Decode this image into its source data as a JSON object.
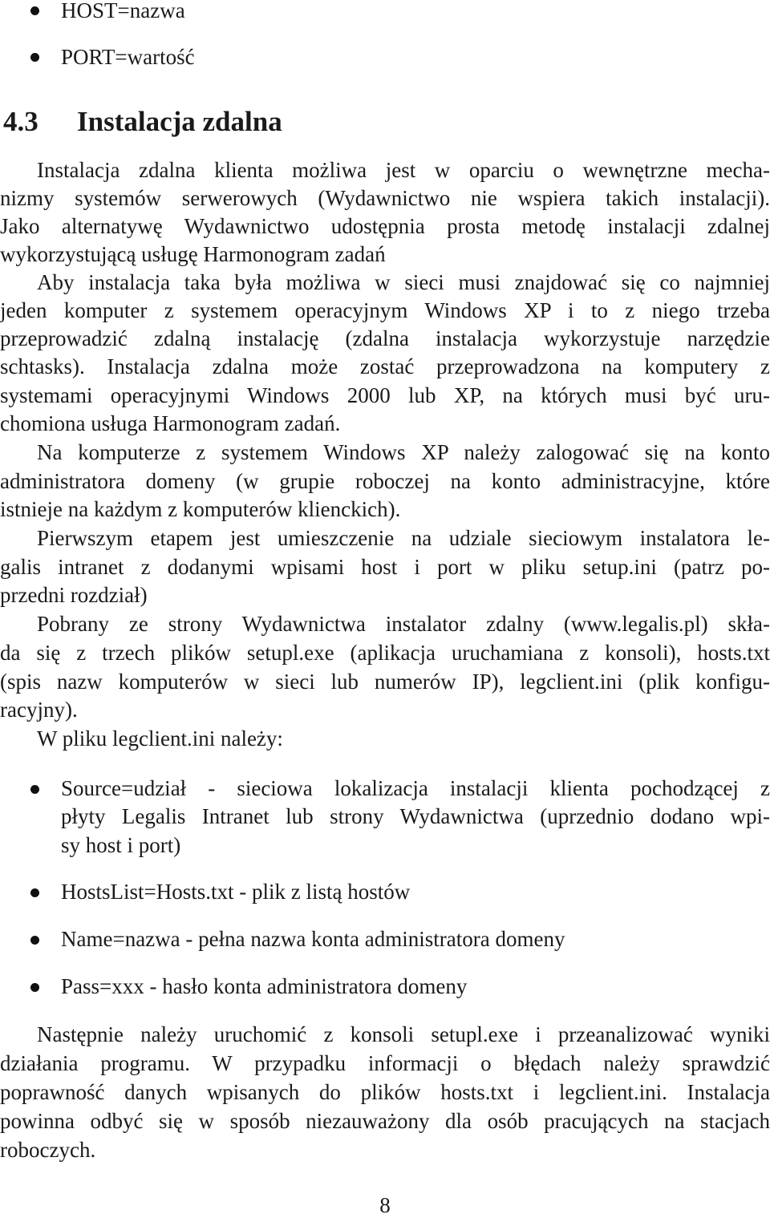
{
  "top_bullets": [
    "HOST=nazwa",
    "PORT=wartość"
  ],
  "section": {
    "number": "4.3",
    "title": "Instalacja zdalna"
  },
  "body_lines": [
    "Instalacja zdalna klienta możliwa jest w oparciu o wewnętrzne mecha-",
    "nizmy systemów serwerowych (Wydawnictwo nie wspiera takich instalacji).",
    "Jako alternatywę Wydawnictwo udostępnia prosta metodę instalacji zdalnej",
    "wykorzystującą usługę Harmonogram zadań",
    "Aby instalacja taka była możliwa w sieci musi znajdować się co najmniej",
    "jeden komputer z systemem operacyjnym Windows XP i to z niego trzeba",
    "przeprowadzić zdalną instalację (zdalna instalacja wykorzystuje narzędzie",
    "schtasks). Instalacja zdalna może zostać przeprowadzona na komputery z",
    "systemami operacyjnymi Windows 2000 lub XP, na których musi być uru-",
    "chomiona usługa Harmonogram zadań.",
    "Na komputerze z systemem Windows XP należy zalogować się na konto",
    "administratora domeny (w grupie roboczej na konto administracyjne, które",
    "istnieje na każdym z komputerów klienckich).",
    "Pierwszym etapem jest umieszczenie na udziale sieciowym instalatora le-",
    "galis intranet z dodanymi wpisami host i port w pliku setup.ini (patrz po-",
    "przedni rozdział)",
    "Pobrany ze strony Wydawnictwa instalator zdalny (www.legalis.pl) skła-",
    "da się z trzech plików setupl.exe (aplikacja uruchamiana z konsoli), hosts.txt",
    "(spis nazw komputerów w sieci lub numerów IP), legclient.ini (plik konfigu-",
    "racyjny).",
    "W pliku legclient.ini należy:"
  ],
  "config_bullets": [
    {
      "lines": [
        "Source=udział - sieciowa lokalizacja instalacji klienta pochodzącej z",
        "płyty Legalis Intranet lub strony Wydawnictwa (uprzednio dodano wpi-",
        "sy host i port)"
      ]
    },
    {
      "lines": [
        "HostsList=Hosts.txt - plik z listą hostów"
      ]
    },
    {
      "lines": [
        "Name=nazwa - pełna nazwa konta administratora domeny"
      ]
    },
    {
      "lines": [
        "Pass=xxx - hasło konta administratora domeny"
      ]
    }
  ],
  "final_lines": [
    "Następnie należy uruchomić z konsoli setupl.exe i przeanalizować wyniki",
    "działania programu. W przypadku informacji o błędach należy sprawdzić",
    "poprawność danych wpisanych do plików hosts.txt i legclient.ini. Instalacja",
    "powinna odbyć się w sposób niezauważony dla osób pracujących na stacjach",
    "roboczych."
  ],
  "page_number": "8"
}
